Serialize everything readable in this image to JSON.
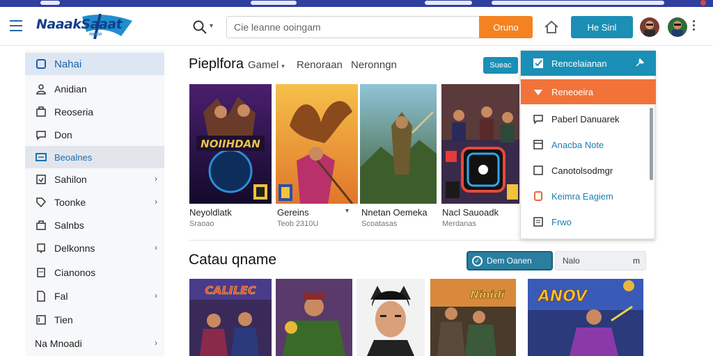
{
  "header": {
    "logo_text": "NaaakSaaat",
    "logo_sub": "naaio",
    "search_placeholder": "Cie leanne ooingam",
    "search_button": "Oruno",
    "signin_button": "He  Sinl"
  },
  "sidebar": {
    "items": [
      {
        "label": "Nahai",
        "icon": "gamepad-icon",
        "active": true
      },
      {
        "label": "Anidian",
        "icon": "user-icon"
      },
      {
        "label": "Reoseria",
        "icon": "briefcase-icon"
      },
      {
        "label": "Don",
        "icon": "chat-icon"
      },
      {
        "label": "Beoalnes",
        "icon": "folder-icon",
        "active2": true
      },
      {
        "label": "Sahilon",
        "icon": "box-icon",
        "chevron": "›"
      },
      {
        "label": "Toonke",
        "icon": "tag-icon",
        "chevron": "›"
      },
      {
        "label": "Salnbs",
        "icon": "bag-icon"
      },
      {
        "label": "Delkonns",
        "icon": "trophy-icon",
        "chevron": "›"
      },
      {
        "label": "Cianonos",
        "icon": "clipboard-icon"
      },
      {
        "label": "Fal",
        "icon": "doc-icon",
        "chevron": "›"
      },
      {
        "label": "Tien",
        "icon": "list-icon"
      },
      {
        "label": "Na  Mnoadi",
        "icon": "",
        "chevron": "›"
      }
    ]
  },
  "popular": {
    "title": "Pieplfora",
    "tabs": [
      {
        "label": "Gamel",
        "caret": "▾"
      },
      {
        "label": "Renoraan"
      },
      {
        "label": "Neronngn"
      }
    ],
    "small_button": "Sueac",
    "cards": [
      {
        "title": "Neyoldlatk",
        "sub": "Sraoao",
        "caret": "",
        "art_text": "NOIIHDAN"
      },
      {
        "title": "Gereins",
        "sub": "Teob  2310U",
        "caret": "▾"
      },
      {
        "title": "Nnetan Oemeka",
        "sub": "Scoatasas",
        "caret": ""
      },
      {
        "title": "Nacl Sauoadk",
        "sub": "Merdanas",
        "caret": ""
      }
    ]
  },
  "catalog": {
    "title": "Catau qname",
    "filter_button": "Dem Oanen",
    "sort_label": "Nalo",
    "sort_icon": "m",
    "card_texts": [
      "CALILEC",
      "Ninidi",
      "ANOV"
    ]
  },
  "dropdown": {
    "items": [
      {
        "label": "Rencelaianan",
        "style": "hdr",
        "icon": "checkbox-icon"
      },
      {
        "label": "Reneoeira",
        "style": "hl",
        "icon": "star-icon"
      },
      {
        "label": "Paberl Danuarek",
        "style": "",
        "icon": "chat-icon"
      },
      {
        "label": "Anacba Note",
        "style": "blue",
        "icon": "tray-icon"
      },
      {
        "label": "Canotolsodmgr",
        "style": "",
        "icon": "square-icon"
      },
      {
        "label": "Keimra Eagiem",
        "style": "blue",
        "icon": "bookmark-icon"
      },
      {
        "label": "Frwo",
        "style": "blue",
        "icon": "window-icon"
      }
    ]
  },
  "colors": {
    "accent_blue": "#1b8fb5",
    "accent_orange": "#f58220",
    "brand_navy": "#123d8a"
  }
}
